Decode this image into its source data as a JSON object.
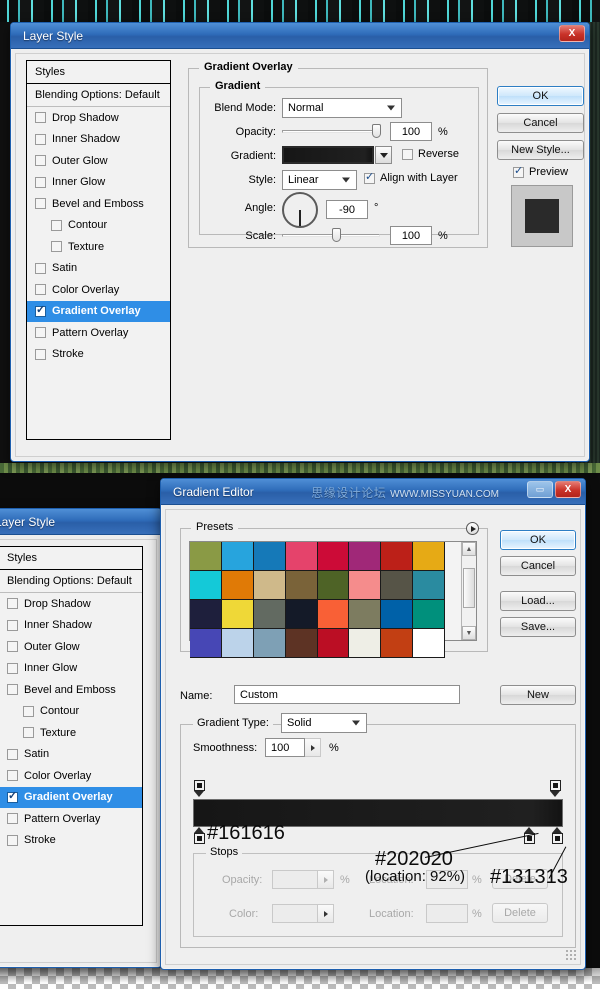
{
  "meta": {
    "watermark_cn": "思缘设计论坛",
    "watermark_en": "WWW.MISSYUAN.COM"
  },
  "layer_style_dialog": {
    "title": "Layer Style",
    "close_label": "X",
    "styles_header": "Styles",
    "blending_options": "Blending Options: Default",
    "style_items": [
      {
        "label": "Drop Shadow",
        "checked": false,
        "indent": false,
        "selected": false
      },
      {
        "label": "Inner Shadow",
        "checked": false,
        "indent": false,
        "selected": false
      },
      {
        "label": "Outer Glow",
        "checked": false,
        "indent": false,
        "selected": false
      },
      {
        "label": "Inner Glow",
        "checked": false,
        "indent": false,
        "selected": false
      },
      {
        "label": "Bevel and Emboss",
        "checked": false,
        "indent": false,
        "selected": false
      },
      {
        "label": "Contour",
        "checked": false,
        "indent": true,
        "selected": false
      },
      {
        "label": "Texture",
        "checked": false,
        "indent": true,
        "selected": false
      },
      {
        "label": "Satin",
        "checked": false,
        "indent": false,
        "selected": false
      },
      {
        "label": "Color Overlay",
        "checked": false,
        "indent": false,
        "selected": false
      },
      {
        "label": "Gradient Overlay",
        "checked": true,
        "indent": false,
        "selected": true
      },
      {
        "label": "Pattern Overlay",
        "checked": false,
        "indent": false,
        "selected": false
      },
      {
        "label": "Stroke",
        "checked": false,
        "indent": false,
        "selected": false
      }
    ],
    "section_title": "Gradient Overlay",
    "group_title": "Gradient",
    "fields": {
      "blend_mode_label": "Blend Mode:",
      "blend_mode_value": "Normal",
      "opacity_label": "Opacity:",
      "opacity_value": "100",
      "opacity_unit": "%",
      "gradient_label": "Gradient:",
      "reverse_label": "Reverse",
      "reverse_checked": false,
      "style_label": "Style:",
      "style_value": "Linear",
      "align_label": "Align with Layer",
      "align_checked": true,
      "angle_label": "Angle:",
      "angle_value": "-90",
      "angle_unit": "°",
      "scale_label": "Scale:",
      "scale_value": "100",
      "scale_unit": "%"
    },
    "buttons": {
      "ok": "OK",
      "cancel": "Cancel",
      "new_style": "New Style...",
      "preview": "Preview",
      "preview_checked": true
    }
  },
  "layer_style_dialog_2": {
    "title": "Layer Style",
    "styles_header": "Styles",
    "blending_options": "Blending Options: Default",
    "style_items": [
      {
        "label": "Drop Shadow",
        "checked": false,
        "indent": false,
        "selected": false
      },
      {
        "label": "Inner Shadow",
        "checked": false,
        "indent": false,
        "selected": false
      },
      {
        "label": "Outer Glow",
        "checked": false,
        "indent": false,
        "selected": false
      },
      {
        "label": "Inner Glow",
        "checked": false,
        "indent": false,
        "selected": false
      },
      {
        "label": "Bevel and Emboss",
        "checked": false,
        "indent": false,
        "selected": false
      },
      {
        "label": "Contour",
        "checked": false,
        "indent": true,
        "selected": false
      },
      {
        "label": "Texture",
        "checked": false,
        "indent": true,
        "selected": false
      },
      {
        "label": "Satin",
        "checked": false,
        "indent": false,
        "selected": false
      },
      {
        "label": "Color Overlay",
        "checked": false,
        "indent": false,
        "selected": false
      },
      {
        "label": "Gradient Overlay",
        "checked": true,
        "indent": false,
        "selected": true
      },
      {
        "label": "Pattern Overlay",
        "checked": false,
        "indent": false,
        "selected": false
      },
      {
        "label": "Stroke",
        "checked": false,
        "indent": false,
        "selected": false
      }
    ]
  },
  "gradient_editor": {
    "title": "Gradient Editor",
    "minimize_label": "▭",
    "close_label": "X",
    "presets_label": "Presets",
    "preset_colors": [
      "#8a9a45",
      "#27a4dd",
      "#1579b8",
      "#e5436b",
      "#cc0b37",
      "#a02878",
      "#bc2018",
      "#e6aa15",
      "#14c9d8",
      "#e07a06",
      "#cfb98a",
      "#7a6339",
      "#4e6326",
      "#f58c8c",
      "#565447",
      "#2a8ba0",
      "#1e1f3c",
      "#efd837",
      "#626a61",
      "#141a28",
      "#f96036",
      "#7d7c60",
      "#0061a8",
      "#00907c",
      "#4747b5",
      "#bcd3ea",
      "#7ea0b5",
      "#5d3324",
      "#bb0e24",
      "#eeeee6",
      "#c23f13",
      "#ffffff"
    ],
    "name_label": "Name:",
    "name_value": "Custom",
    "new_button": "New",
    "gradient_type_label": "Gradient Type:",
    "gradient_type_value": "Solid",
    "smoothness_label": "Smoothness:",
    "smoothness_value": "100",
    "smoothness_unit": "%",
    "buttons": {
      "ok": "OK",
      "cancel": "Cancel",
      "load": "Load...",
      "save": "Save..."
    },
    "stops_group_label": "Stops",
    "stops_fields": {
      "opacity_label": "Opacity:",
      "opacity_unit": "%",
      "location_label_1": "Location:",
      "location_unit_1": "%",
      "delete_1": "Delete",
      "color_label": "Color:",
      "location_label_2": "Location:",
      "location_unit_2": "%",
      "delete_2": "Delete"
    },
    "annotations": {
      "stop_left_hex": "#161616",
      "stop_mid_hex": "#202020",
      "stop_mid_location": "(location: 92%)",
      "stop_right_hex": "#131313"
    },
    "gradient_stops": [
      {
        "hex": "#161616",
        "location": 0
      },
      {
        "hex": "#202020",
        "location": 92
      },
      {
        "hex": "#131313",
        "location": 100
      }
    ]
  }
}
